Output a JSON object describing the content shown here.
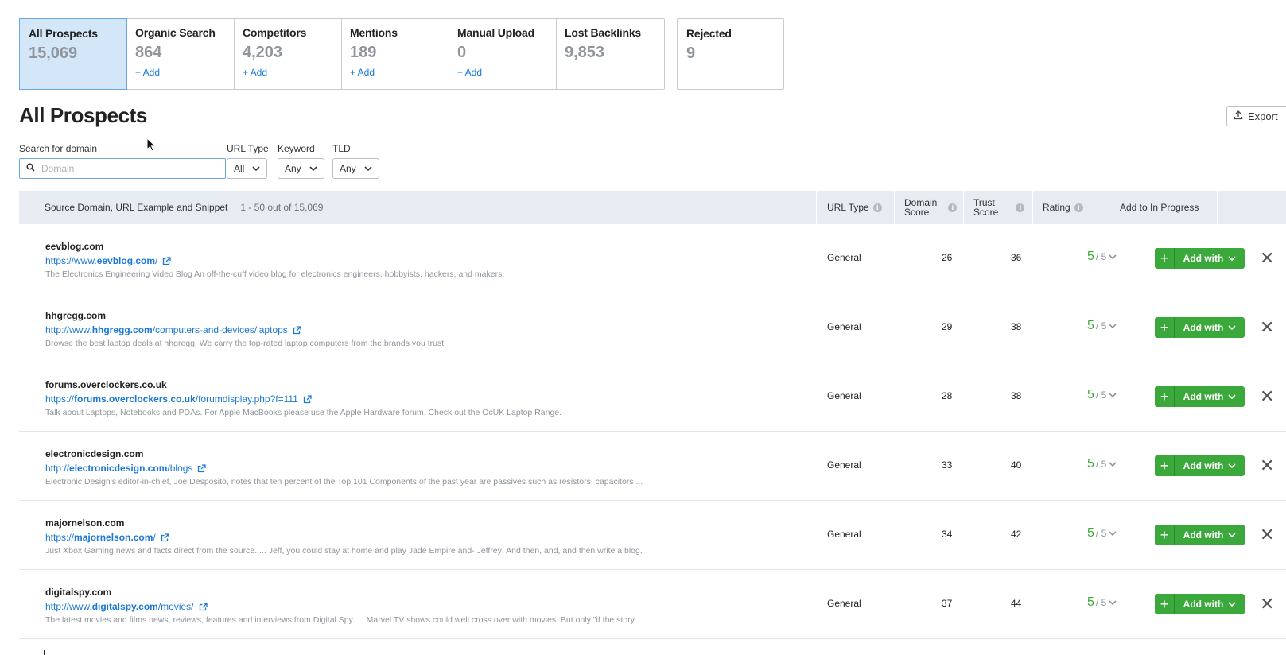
{
  "tabs": [
    {
      "title": "All Prospects",
      "count": "15,069",
      "add": ""
    },
    {
      "title": "Organic Search",
      "count": "864",
      "add": "+ Add"
    },
    {
      "title": "Competitors",
      "count": "4,203",
      "add": "+ Add"
    },
    {
      "title": "Mentions",
      "count": "189",
      "add": "+ Add"
    },
    {
      "title": "Manual Upload",
      "count": "0",
      "add": "+ Add"
    },
    {
      "title": "Lost Backlinks",
      "count": "9,853",
      "add": ""
    }
  ],
  "rejected": {
    "title": "Rejected",
    "count": "9"
  },
  "page_title": "All Prospects",
  "export_label": "Export",
  "filters": {
    "search_label": "Search for domain",
    "search_placeholder": "Domain",
    "url_type_label": "URL Type",
    "url_type_value": "All",
    "keyword_label": "Keyword",
    "keyword_value": "Any",
    "tld_label": "TLD",
    "tld_value": "Any"
  },
  "table": {
    "headers": {
      "source": "Source Domain, URL Example and Snippet",
      "range": "1 - 50 out of 15,069",
      "url_type": "URL Type",
      "domain_score_1": "Domain",
      "domain_score_2": "Score",
      "trust_score_1": "Trust",
      "trust_score_2": "Score",
      "rating": "Rating",
      "add": "Add to In Progress"
    },
    "add_label": "Add with",
    "rating_max": "/ 5",
    "rows": [
      {
        "domain": "eevblog.com",
        "url_pre": "https://www.",
        "url_bold": "eevblog.com",
        "url_post": "/",
        "snippet": "The Electronics Engineering Video Blog An off-the-cuff video blog for electronics engineers, hobbyists, hackers, and makers.",
        "url_type": "General",
        "domain_score": "26",
        "trust_score": "36",
        "rating": "5"
      },
      {
        "domain": "hhgregg.com",
        "url_pre": "http://www.",
        "url_bold": "hhgregg.com",
        "url_post": "/computers-and-devices/laptops",
        "snippet": "Browse the best laptop deals at hhgregg. We carry the top-rated laptop computers from the brands you trust.",
        "url_type": "General",
        "domain_score": "29",
        "trust_score": "38",
        "rating": "5"
      },
      {
        "domain": "forums.overclockers.co.uk",
        "url_pre": "https://",
        "url_bold": "forums.overclockers.co.uk",
        "url_post": "/forumdisplay.php?f=111",
        "snippet": "Talk about Laptops, Notebooks and PDAs. For Apple MacBooks please use the Apple Hardware forum. Check out the OcUK Laptop Range.",
        "url_type": "General",
        "domain_score": "28",
        "trust_score": "38",
        "rating": "5"
      },
      {
        "domain": "electronicdesign.com",
        "url_pre": "http://",
        "url_bold": "electronicdesign.com",
        "url_post": "/blogs",
        "snippet": "Electronic Design's editor-in-chief, Joe Desposito, notes that ten percent of the Top 101 Components of the past year are passives such as resistors, capacitors ...",
        "url_type": "General",
        "domain_score": "33",
        "trust_score": "40",
        "rating": "5"
      },
      {
        "domain": "majornelson.com",
        "url_pre": "https://",
        "url_bold": "majornelson.com",
        "url_post": "/",
        "snippet": "Just Xbox Gaming news and facts direct from the source. ... Jeff, you could stay at home and play Jade Empire and- Jeffrey: And then, and, and then write a blog.",
        "url_type": "General",
        "domain_score": "34",
        "trust_score": "42",
        "rating": "5"
      },
      {
        "domain": "digitalspy.com",
        "url_pre": "http://www.",
        "url_bold": "digitalspy.com",
        "url_post": "/movies/",
        "snippet": "The latest movies and films news, reviews, features and interviews from Digital Spy. ... Marvel TV shows could well cross over with movies. But only \"if the story ...",
        "url_type": "General",
        "domain_score": "37",
        "trust_score": "44",
        "rating": "5"
      }
    ]
  }
}
